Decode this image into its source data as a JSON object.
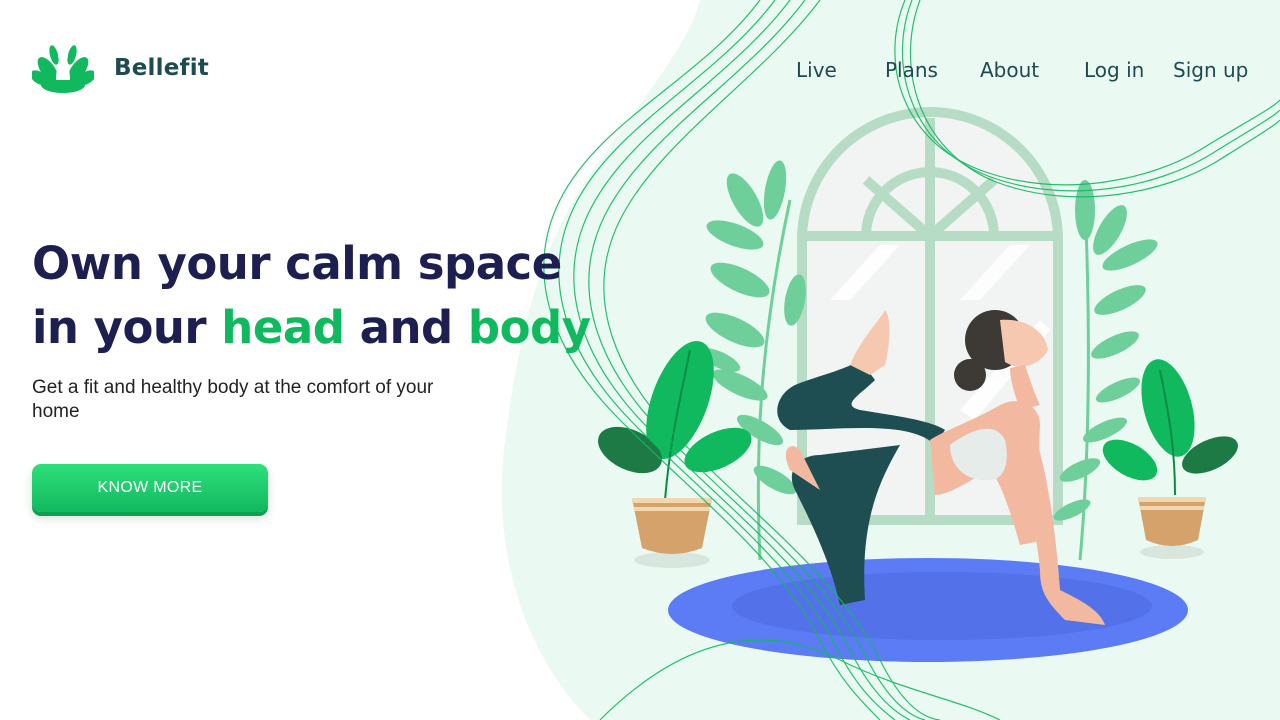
{
  "brand": {
    "name": "Bellefit",
    "logo_icon": "lotus-yoga-icon",
    "color": "#10b95e"
  },
  "nav": {
    "items": [
      {
        "label": "Live"
      },
      {
        "label": "Plans"
      },
      {
        "label": "About"
      },
      {
        "label": "Log in"
      },
      {
        "label": "Sign up"
      }
    ]
  },
  "hero": {
    "line1": "Own your calm space",
    "line2_a": "in your ",
    "line2_accent1": "head",
    "line2_b": " and ",
    "line2_accent2": "body",
    "subtitle": "Get a fit and healthy body at the comfort of your home",
    "cta_label": "KNOW MORE"
  },
  "colors": {
    "heading": "#1c1f4f",
    "accent": "#10b95e",
    "nav_text": "#1d4b4f",
    "background_tint": "#eafaf2",
    "mat": "#5b7cf5"
  },
  "illustration": {
    "icon": "yoga-woman-illustration"
  }
}
